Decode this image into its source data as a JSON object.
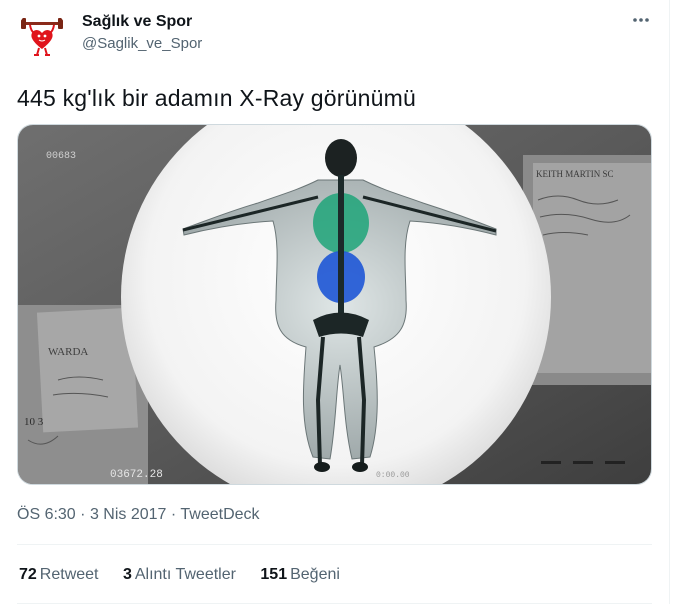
{
  "author": {
    "name": "Sağlık ve Spor",
    "handle": "@Saglik_ve_Spor",
    "avatar_icon": "heart-dumbbell-logo-icon"
  },
  "tweet": {
    "text": "445 kg'lık bir adamın X-Ray görünümü",
    "media": {
      "top_left_code": "00683",
      "bottom_counter": "03672.28",
      "bottom_code": "0:00.00",
      "paper_header": "KEITH MARTIN  SC",
      "ward_label": "WARDA",
      "note_left": "10 3"
    }
  },
  "meta": {
    "time": "ÖS 6:30",
    "dot": "·",
    "date": "3 Nis 2017",
    "source": "TweetDeck"
  },
  "stats": {
    "retweets_count": "72",
    "retweets_label": "Retweet",
    "quotes_count": "3",
    "quotes_label": "Alıntı Tweetler",
    "likes_count": "151",
    "likes_label": "Beğeni"
  },
  "colors": {
    "text_primary": "#0f1419",
    "text_secondary": "#536471",
    "divider": "#eff3f4",
    "avatar_heart": "#e0141c",
    "xray_green": "#1fa579",
    "xray_blue": "#1e56d6"
  }
}
